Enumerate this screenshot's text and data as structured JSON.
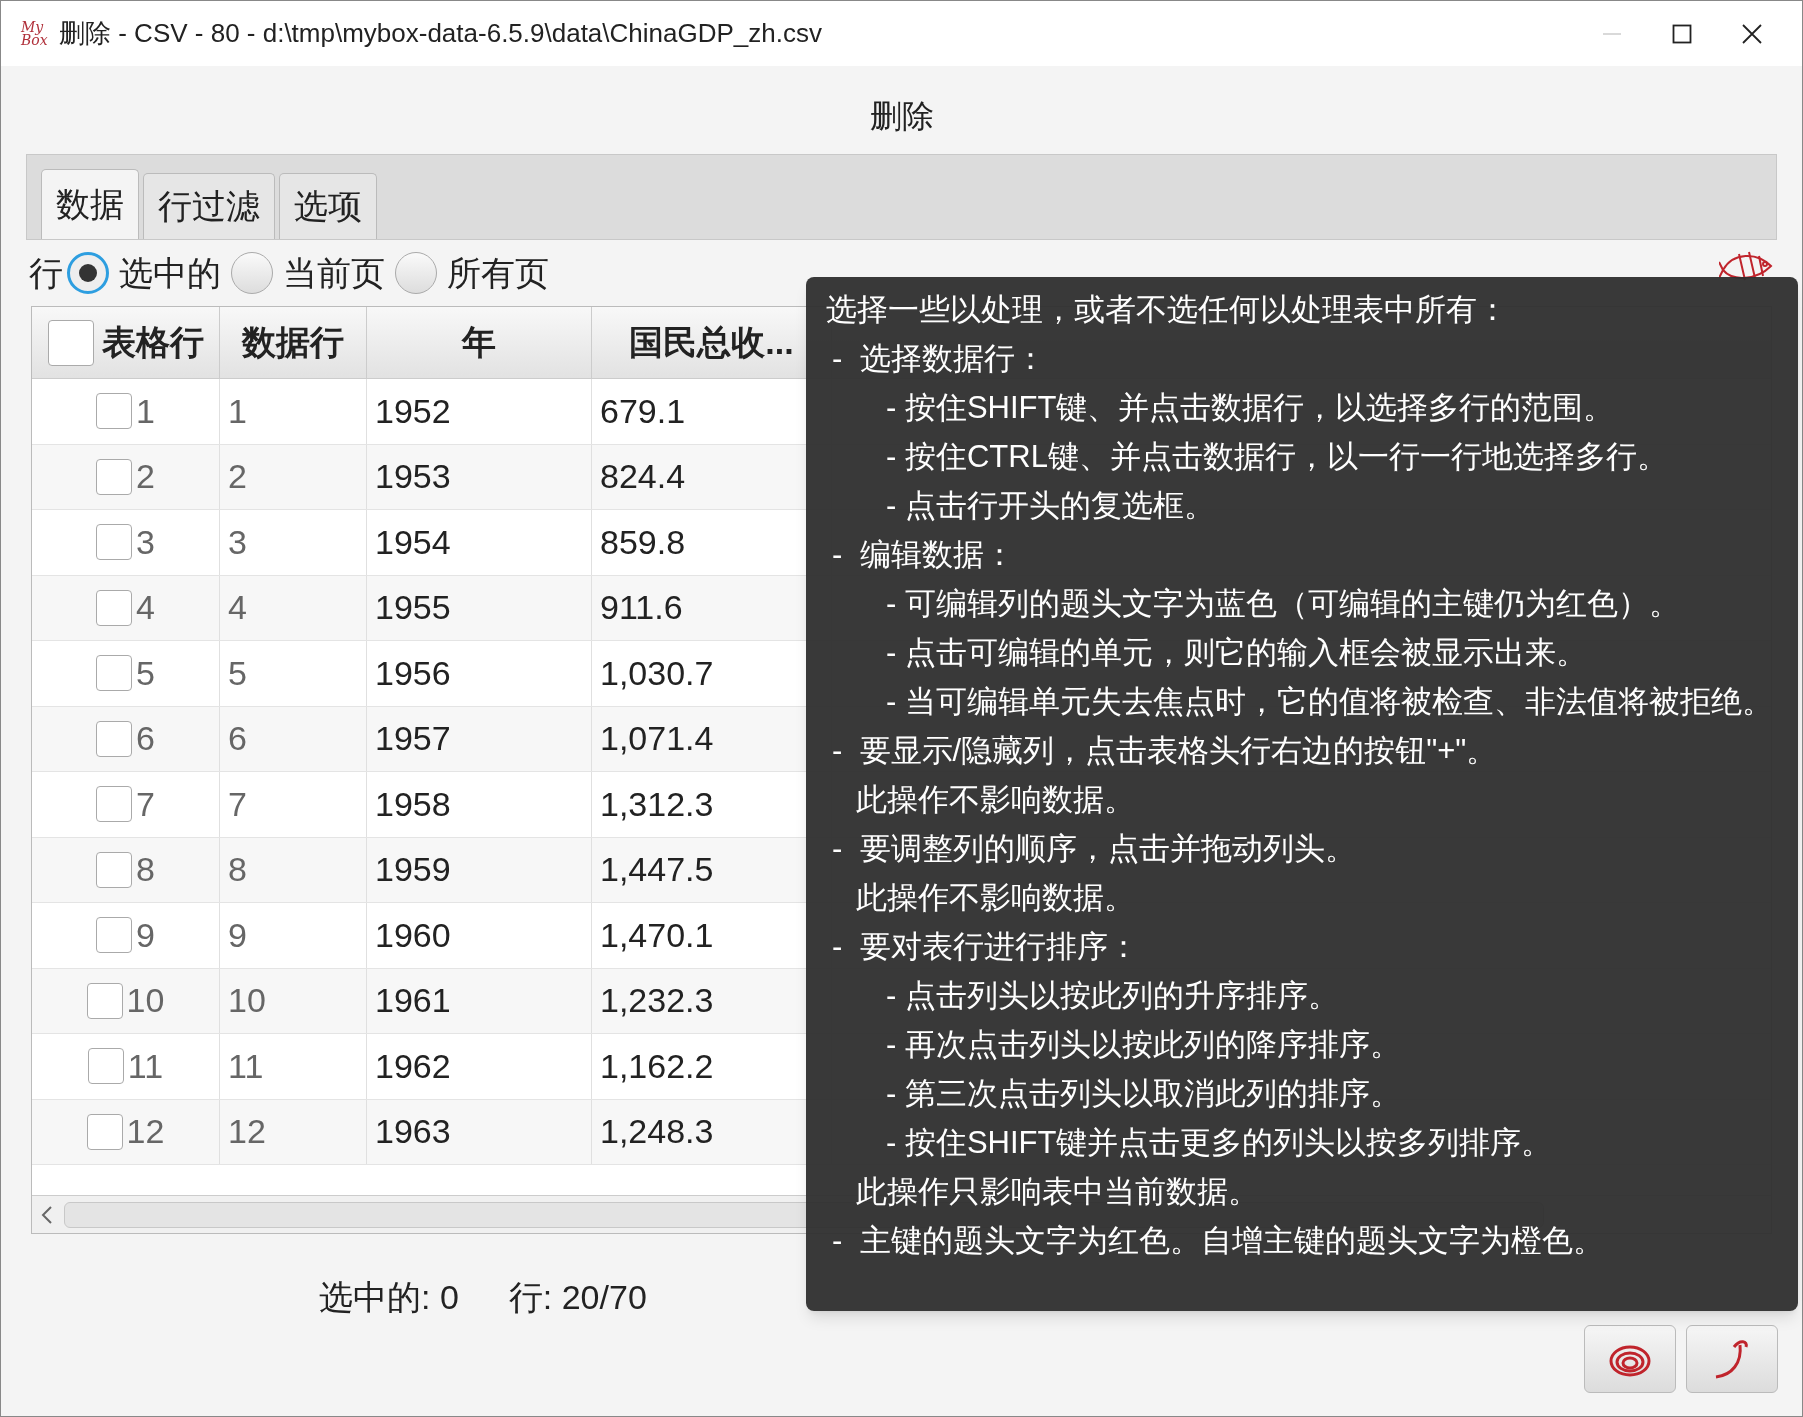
{
  "window": {
    "logo": "My Box",
    "title": "删除 - CSV - 80 - d:\\tmp\\mybox-data-6.5.9\\data\\ChinaGDP_zh.csv"
  },
  "heading": "删除",
  "tabs": [
    {
      "label": "数据",
      "selected": true
    },
    {
      "label": "行过滤",
      "selected": false
    },
    {
      "label": "选项",
      "selected": false
    }
  ],
  "rows_choice": {
    "label": "行",
    "options": [
      {
        "label": "选中的",
        "selected": true
      },
      {
        "label": "当前页",
        "selected": false
      },
      {
        "label": "所有页",
        "selected": false
      }
    ]
  },
  "table": {
    "header_checked": false,
    "columns": [
      "表格行",
      "数据行",
      "年",
      "国民总收..."
    ],
    "rows": [
      {
        "checked": false,
        "cells": [
          "1",
          "1",
          "1952",
          "679.1"
        ]
      },
      {
        "checked": false,
        "cells": [
          "2",
          "2",
          "1953",
          "824.4"
        ]
      },
      {
        "checked": false,
        "cells": [
          "3",
          "3",
          "1954",
          "859.8"
        ]
      },
      {
        "checked": false,
        "cells": [
          "4",
          "4",
          "1955",
          "911.6"
        ]
      },
      {
        "checked": false,
        "cells": [
          "5",
          "5",
          "1956",
          "1,030.7"
        ]
      },
      {
        "checked": false,
        "cells": [
          "6",
          "6",
          "1957",
          "1,071.4"
        ]
      },
      {
        "checked": false,
        "cells": [
          "7",
          "7",
          "1958",
          "1,312.3"
        ]
      },
      {
        "checked": false,
        "cells": [
          "8",
          "8",
          "1959",
          "1,447.5"
        ]
      },
      {
        "checked": false,
        "cells": [
          "9",
          "9",
          "1960",
          "1,470.1"
        ]
      },
      {
        "checked": false,
        "cells": [
          "10",
          "10",
          "1961",
          "1,232.3"
        ]
      },
      {
        "checked": false,
        "cells": [
          "11",
          "11",
          "1962",
          "1,162.2"
        ]
      },
      {
        "checked": false,
        "cells": [
          "12",
          "12",
          "1963",
          "1,248.3"
        ]
      }
    ]
  },
  "status": {
    "selected": "选中的: 0",
    "rows": "行: 20/70"
  },
  "tooltip": {
    "intro": "选择一些以处理，或者不选任何以处理表中所有：",
    "items": [
      {
        "text": "-  选择数据行：",
        "children": [
          {
            "text": "- 按住SHIFT键、并点击数据行，以选择多行的范围。"
          },
          {
            "text": "- 按住CTRL键、并点击数据行，以一行一行地选择多行。"
          },
          {
            "text": "- 点击行开头的复选框。"
          }
        ]
      },
      {
        "text": "-  编辑数据：",
        "children": [
          {
            "text": "- 可编辑列的题头文字为蓝色（可编辑的主键仍为红色）。"
          },
          {
            "text": "- 点击可编辑的单元，则它的输入框会被显示出来。"
          },
          {
            "text": "- 当可编辑单元失去焦点时，它的值将被检查、非法值将被拒绝。"
          }
        ]
      },
      {
        "text": "-  要显示/隐藏列，点击表格头行右边的按钮\"+\"。",
        "note": "此操作不影响数据。"
      },
      {
        "text": "-  要调整列的顺序，点击并拖动列头。",
        "note": "此操作不影响数据。"
      },
      {
        "text": "-  要对表行进行排序：",
        "children": [
          {
            "text": "- 点击列头以按此列的升序排序。"
          },
          {
            "text": "- 再次点击列头以按此列的降序排序。"
          },
          {
            "text": "- 第三次点击列头以取消此列的排序。"
          },
          {
            "text": "- 按住SHIFT键并点击更多的列头以按多列排序。"
          }
        ],
        "note": "此操作只影响表中当前数据。"
      },
      {
        "text": "-  主键的题头文字为红色。自增主键的题头文字为橙色。"
      }
    ]
  }
}
